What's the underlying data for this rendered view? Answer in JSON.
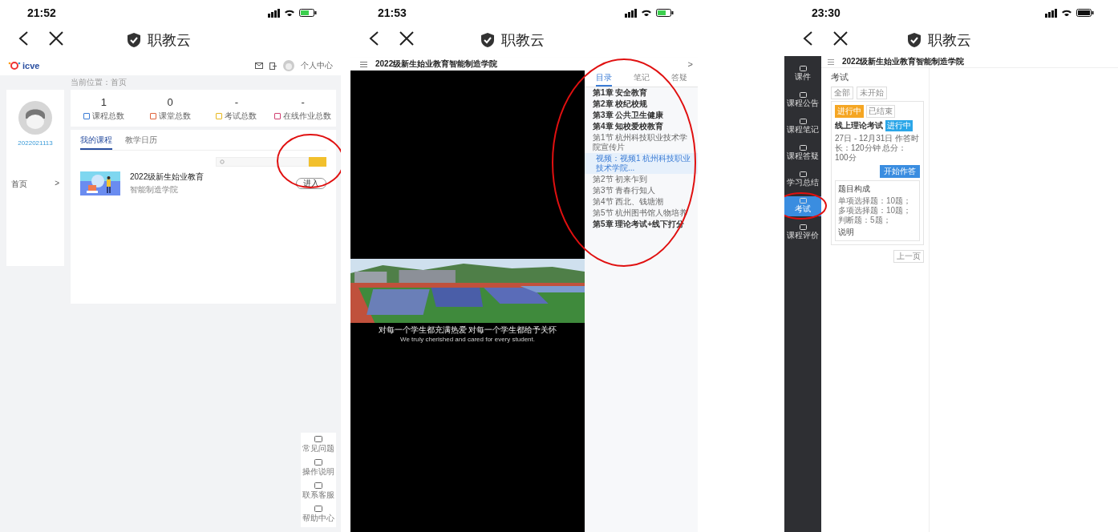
{
  "screen_1": {
    "status_bar": {
      "time": "21:52"
    },
    "nav": {
      "title": "职教云"
    },
    "header": {
      "logo": "icve",
      "user_link": "个人中心"
    },
    "breadcrumb": "当前位置：首页",
    "profile": {
      "user_id": "2022021113",
      "menu_item": "首页",
      "menu_arrow": ">"
    },
    "stats": [
      {
        "value": "1",
        "label": "课程总数",
        "color": "#3a7bd5"
      },
      {
        "value": "0",
        "label": "课堂总数",
        "color": "#e0643c"
      },
      {
        "value": "-",
        "label": "考试总数",
        "color": "#e8b820"
      },
      {
        "value": "-",
        "label": "在线作业总数",
        "color": "#d04070"
      }
    ],
    "tabs": [
      {
        "label": "我的课程",
        "selected": true
      },
      {
        "label": "教学日历",
        "selected": false
      }
    ],
    "course": {
      "title": "2022级新生始业教育",
      "college": "智能制造学院",
      "button": "进入"
    },
    "help_tools": [
      {
        "label": "常见问题"
      },
      {
        "label": "操作说明"
      },
      {
        "label": "联系客服"
      },
      {
        "label": "帮助中心"
      }
    ]
  },
  "screen_2": {
    "status_bar": {
      "time": "21:53"
    },
    "nav": {
      "title": "职教云"
    },
    "course_title": "2022级新生始业教育智能制造学院",
    "next_arrow": ">",
    "subtitles": [
      "对每一个学生都充满热爱 对每一个学生都给予关怀",
      "We truly cherished and cared for every student."
    ],
    "tabs": [
      {
        "label": "目录",
        "selected": true
      },
      {
        "label": "笔记",
        "selected": false
      },
      {
        "label": "答疑",
        "selected": false
      }
    ],
    "catalog": [
      {
        "kind": "chapter",
        "label": "第1章 安全教育",
        "selected": false
      },
      {
        "kind": "chapter",
        "label": "第2章 校纪校规",
        "selected": false
      },
      {
        "kind": "chapter",
        "label": "第3章 公共卫生健康",
        "selected": false
      },
      {
        "kind": "chapter",
        "label": "第4章 知校爱校教育",
        "selected": false
      },
      {
        "kind": "section",
        "label": "第1节 杭州科技职业技术学院宣传片",
        "selected": false
      },
      {
        "kind": "video",
        "label": "视频：视频1 杭州科技职业技术学院...",
        "selected": true
      },
      {
        "kind": "section",
        "label": "第2节 初来乍到",
        "selected": false
      },
      {
        "kind": "section",
        "label": "第3节 青春行知人",
        "selected": false
      },
      {
        "kind": "section",
        "label": "第4节 西北、钱塘潮",
        "selected": false
      },
      {
        "kind": "section",
        "label": "第5节 杭州图书馆人物培养",
        "selected": false
      },
      {
        "kind": "chapter",
        "label": "第5章 理论考试+线下打分",
        "selected": false
      }
    ]
  },
  "screen_3": {
    "status_bar": {
      "time": "23:30"
    },
    "nav": {
      "title": "职教云"
    },
    "sidebar": [
      {
        "label": "课件",
        "selected": false
      },
      {
        "label": "课程公告",
        "selected": false
      },
      {
        "label": "课程笔记",
        "selected": false
      },
      {
        "label": "课程答疑",
        "selected": false
      },
      {
        "label": "学习总结",
        "selected": false
      },
      {
        "label": "考试",
        "selected": true
      },
      {
        "label": "课程评价",
        "selected": false
      }
    ],
    "course_title": "2022级新生始业教育智能制造学院",
    "panel_title": "考试",
    "filters": [
      {
        "label": "全部",
        "selected": false
      },
      {
        "label": "未开始",
        "selected": false
      }
    ],
    "status_tabs": [
      {
        "label": "进行中",
        "selected": true
      },
      {
        "label": "已结束",
        "selected": false
      }
    ],
    "exam": {
      "title": "线上理论考试",
      "badge": "进行中",
      "info": "27日 - 12月31日 作答时长：120分钟 总分：100分",
      "button": "开始作答",
      "composition_title": "题目构成",
      "composition": "单项选择题：10题；多项选择题：10题；判断题：5题；",
      "note_title": "说明"
    },
    "pager": "上一页"
  }
}
